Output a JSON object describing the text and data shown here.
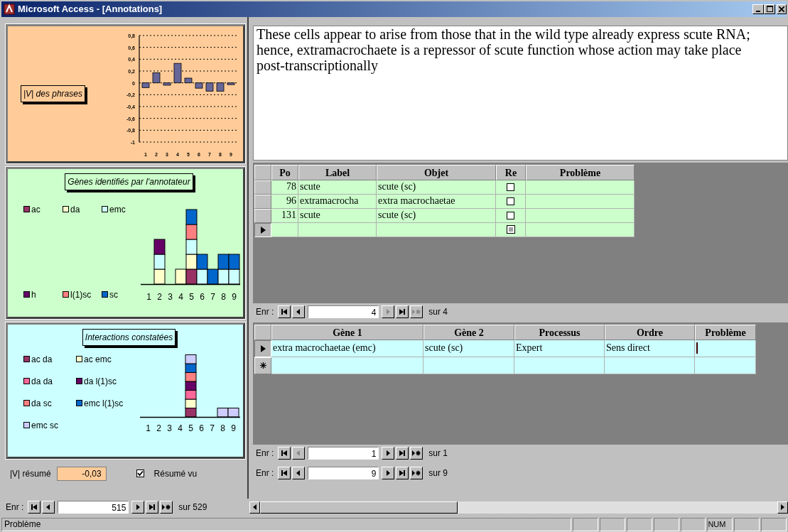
{
  "window": {
    "title": "Microsoft Access - [Annotations]"
  },
  "phrases_panel": {
    "title": "|V| des phrases",
    "chart_data": {
      "type": "bar",
      "categories": [
        "1",
        "2",
        "3",
        "4",
        "5",
        "6",
        "7",
        "8",
        "9"
      ],
      "series": [
        {
          "color": "#666699",
          "values": [
            -0.08,
            0.17,
            -0.04,
            0.33,
            0.08,
            -0.09,
            -0.14,
            -0.14,
            -0.03
          ]
        }
      ],
      "grid": true,
      "ylim": [
        -1,
        0.8
      ],
      "yticks": [
        {
          "value": 0.8,
          "label": "0,8"
        },
        {
          "value": 0.6,
          "label": "0,6"
        },
        {
          "value": 0.4,
          "label": "0,4"
        },
        {
          "value": 0.2,
          "label": "0,2"
        },
        {
          "value": 0,
          "label": "0"
        },
        {
          "value": -0.2,
          "label": "-0,2"
        },
        {
          "value": -0.4,
          "label": "-0,4"
        },
        {
          "value": -0.6,
          "label": "-0,6"
        },
        {
          "value": -0.8,
          "label": "-0,8"
        },
        {
          "value": -1,
          "label": "-1"
        }
      ]
    }
  },
  "genes_panel": {
    "title": "Gènes identifiés par l'annotateur",
    "x_labels": [
      "1",
      "2",
      "3",
      "4",
      "5",
      "6",
      "7",
      "8",
      "9"
    ],
    "legend": [
      {
        "name": "ac",
        "color": "#993366"
      },
      {
        "name": "da",
        "color": "#ffffcc"
      },
      {
        "name": "emc",
        "color": "#ccffff"
      },
      {
        "name": "h",
        "color": "#660066"
      },
      {
        "name": "l(1)sc",
        "color": "#ff8080"
      },
      {
        "name": "sc",
        "color": "#0066cc"
      }
    ]
  },
  "interactions_panel": {
    "title": "Interactions constatées",
    "x_labels": [
      "1",
      "2",
      "3",
      "4",
      "5",
      "6",
      "7",
      "8",
      "9"
    ],
    "legend": [
      {
        "name": "ac da",
        "color": "#993366"
      },
      {
        "name": "ac emc",
        "color": "#ffffcc"
      },
      {
        "name": "da da",
        "color": "#ff6699"
      },
      {
        "name": "da l(1)sc",
        "color": "#660066"
      },
      {
        "name": "da sc",
        "color": "#ff8080"
      },
      {
        "name": "emc l(1)sc",
        "color": "#0066cc"
      },
      {
        "name": "emc sc",
        "color": "#ccccff"
      }
    ]
  },
  "summary": {
    "label": "|V| résumé",
    "value": "-0,03",
    "checkbox_label": "Résumé vu",
    "checked": true
  },
  "memo": {
    "text": "These cells appear to arise from those that in the wild type already express scute RNA; hence, extramacrochaete is a repressor of scute function whose action may take place post-transcriptionally"
  },
  "annotations_table": {
    "columns": [
      "Po",
      "Label",
      "Objet",
      "Re",
      "Problème"
    ],
    "rows": [
      {
        "kind": "record",
        "selected": false,
        "po": "78",
        "label": "scute",
        "objet": "scute (sc)",
        "re": false
      },
      {
        "kind": "record",
        "selected": false,
        "po": "96",
        "label": "extramacrocha",
        "objet": "extra macrochaetae",
        "re": false
      },
      {
        "kind": "record",
        "selected": false,
        "po": "131",
        "label": "scute",
        "objet": "scute (sc)",
        "re": false
      },
      {
        "kind": "new",
        "selected": true,
        "re_disabled": true
      }
    ]
  },
  "annotations_nav": {
    "label": "Enr :",
    "value": "4",
    "total": "sur 4",
    "buttons": [
      {
        "kind": "first",
        "disabled": false
      },
      {
        "kind": "prev",
        "disabled": false
      },
      {
        "kind": "next",
        "disabled": true
      },
      {
        "kind": "last",
        "disabled": false
      },
      {
        "kind": "new",
        "disabled": true
      }
    ]
  },
  "interactions_table": {
    "columns": [
      "Gène 1",
      "Gène 2",
      "Processus",
      "Ordre",
      "Problème"
    ],
    "rows": [
      {
        "kind": "record",
        "selected": true,
        "gene1": "extra macrochaetae (emc)",
        "gene2": "scute (sc)",
        "process": "Expert",
        "order": "Sens direct",
        "editing": true
      },
      {
        "kind": "new",
        "selected": false
      }
    ]
  },
  "interactions_nav": {
    "label": "Enr :",
    "value": "1",
    "total": "sur 1",
    "buttons": [
      {
        "kind": "first",
        "disabled": false
      },
      {
        "kind": "prev",
        "disabled": true
      },
      {
        "kind": "next",
        "disabled": false
      },
      {
        "kind": "last",
        "disabled": false
      },
      {
        "kind": "new",
        "disabled": false
      }
    ]
  },
  "phrases_nav": {
    "label": "Enr :",
    "value": "9",
    "total": "sur 9",
    "buttons": [
      {
        "kind": "first",
        "disabled": false
      },
      {
        "kind": "prev",
        "disabled": false
      },
      {
        "kind": "next",
        "disabled": false
      },
      {
        "kind": "last",
        "disabled": false
      },
      {
        "kind": "new",
        "disabled": false
      }
    ]
  },
  "record_nav": {
    "label": "Enr :",
    "value": "515",
    "total": "sur 529",
    "buttons": [
      {
        "kind": "first",
        "disabled": false
      },
      {
        "kind": "prev",
        "disabled": false
      },
      {
        "kind": "next",
        "disabled": false
      },
      {
        "kind": "last",
        "disabled": false
      },
      {
        "kind": "new",
        "disabled": false
      }
    ]
  },
  "status_bar": {
    "text": "Problème",
    "indicators": [
      "NUM"
    ]
  }
}
